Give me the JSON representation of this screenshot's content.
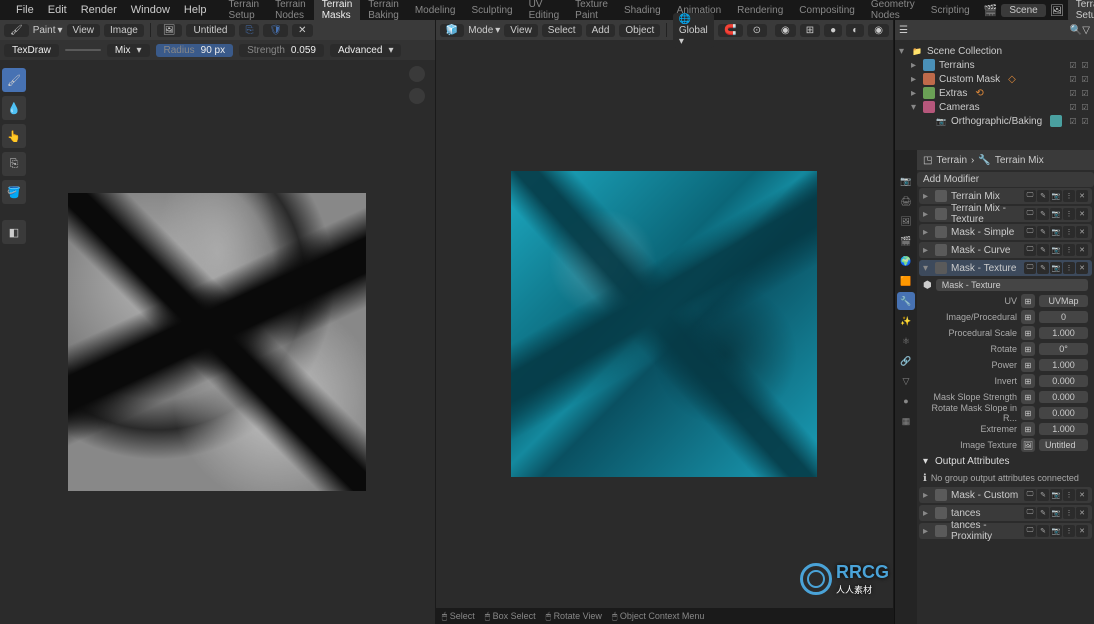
{
  "menubar": {
    "items": [
      "File",
      "Edit",
      "Render",
      "Window",
      "Help"
    ],
    "right": {
      "scene": "Scene",
      "viewlayer": "Terrain Setup"
    }
  },
  "workspace_tabs": {
    "items": [
      "Terrain Setup",
      "Terrain Nodes",
      "Terrain Masks",
      "Terrain Baking",
      "Modeling",
      "Sculpting",
      "UV Editing",
      "Texture Paint",
      "Shading",
      "Animation",
      "Rendering",
      "Compositing",
      "Geometry Nodes",
      "Scripting"
    ],
    "active_index": 2
  },
  "image_editor": {
    "mode_label": "Paint",
    "menus": [
      "View",
      "Image"
    ],
    "image_name": "Untitled",
    "brush_name": "TexDraw",
    "blend": "Mix",
    "radius_label": "Radius",
    "radius_value": "90 px",
    "strength_label": "Strength",
    "strength_value": "0.059",
    "advanced": "Advanced"
  },
  "viewport3d": {
    "mode_label": "Mode",
    "menus": [
      "View",
      "Select",
      "Add",
      "Object"
    ],
    "orientation": "Global"
  },
  "outliner": {
    "collection": "Scene Collection",
    "items": [
      {
        "label": "Terrains",
        "color": "#4a90b8",
        "indent": 1
      },
      {
        "label": "Custom Mask",
        "color": "#bf6a4a",
        "indent": 1,
        "extra": "◇"
      },
      {
        "label": "Extras",
        "color": "#6aa055",
        "indent": 1
      },
      {
        "label": "Cameras",
        "color": "#b6577b",
        "indent": 1
      },
      {
        "label": "Orthographic/Baking",
        "color": "#caa24a",
        "indent": 2
      }
    ]
  },
  "properties": {
    "path": {
      "object": "Terrain",
      "data": "Terrain Mix"
    },
    "add_modifier": "Add Modifier",
    "modifiers": [
      {
        "name": "Terrain Mix",
        "open": false
      },
      {
        "name": "Terrain Mix - Texture",
        "open": false
      },
      {
        "name": "Mask - Simple",
        "open": false
      },
      {
        "name": "Mask - Curve",
        "open": false
      },
      {
        "name": "Mask - Texture",
        "open": true,
        "selected": true
      }
    ],
    "active_modifier_title": "Mask - Texture",
    "params": [
      {
        "label": "UV",
        "value": "UVMap",
        "attr": true
      },
      {
        "label": "Image/Procedural",
        "value": "0"
      },
      {
        "label": "Procedural Scale",
        "value": "1.000"
      },
      {
        "label": "Rotate",
        "value": "0°"
      },
      {
        "label": "Power",
        "value": "1.000"
      },
      {
        "label": "Invert",
        "value": "0.000"
      },
      {
        "label": "Mask Slope Strength",
        "value": "0.000"
      },
      {
        "label": "Rotate Mask Slope in R...",
        "value": "0.000"
      },
      {
        "label": "Extremer",
        "value": "1.000"
      }
    ],
    "image_texture_label": "Image Texture",
    "image_texture_value": "Untitled",
    "output_attrs": "Output Attributes",
    "output_msg": "No group output attributes connected",
    "lower_modifiers": [
      {
        "name": "Mask - Custom"
      },
      {
        "name": "tances"
      },
      {
        "name": "tances - Proximity"
      }
    ]
  },
  "footer": {
    "items": [
      "Select",
      "Box Select",
      "Rotate View",
      "Object Context Menu"
    ]
  }
}
